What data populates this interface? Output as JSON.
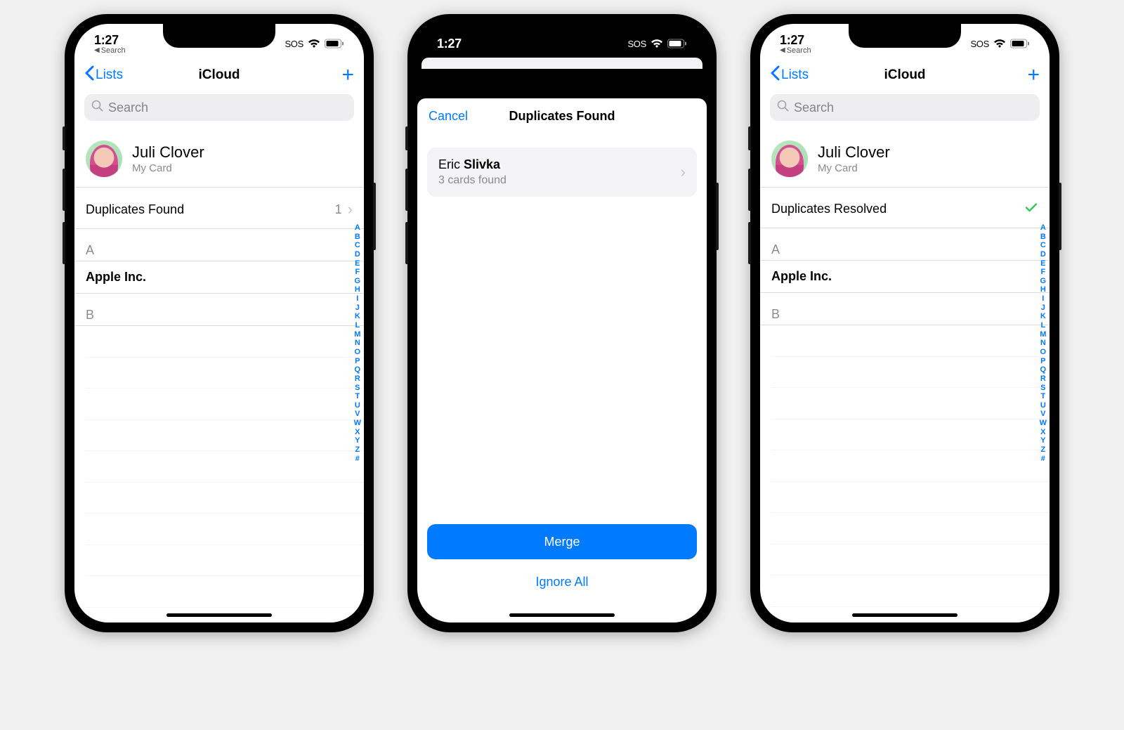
{
  "status": {
    "time": "1:27",
    "breadcrumb": "Search",
    "sos": "SOS"
  },
  "index_letters": [
    "A",
    "B",
    "C",
    "D",
    "E",
    "F",
    "G",
    "H",
    "I",
    "J",
    "K",
    "L",
    "M",
    "N",
    "O",
    "P",
    "Q",
    "R",
    "S",
    "T",
    "U",
    "V",
    "W",
    "X",
    "Y",
    "Z",
    "#"
  ],
  "common": {
    "lists_label": "Lists",
    "icloud_title": "iCloud",
    "search_placeholder": "Search",
    "my_card": {
      "name": "Juli Clover",
      "sub": "My Card"
    },
    "section_A": "A",
    "section_B": "B",
    "apple_contact": "Apple Inc."
  },
  "phone1": {
    "dup_label": "Duplicates Found",
    "dup_count": "1"
  },
  "phone2": {
    "cancel": "Cancel",
    "title": "Duplicates Found",
    "dup_first": "Eric",
    "dup_last": "Slivka",
    "dup_sub": "3 cards found",
    "merge": "Merge",
    "ignore": "Ignore All"
  },
  "phone3": {
    "resolved_label": "Duplicates Resolved"
  }
}
